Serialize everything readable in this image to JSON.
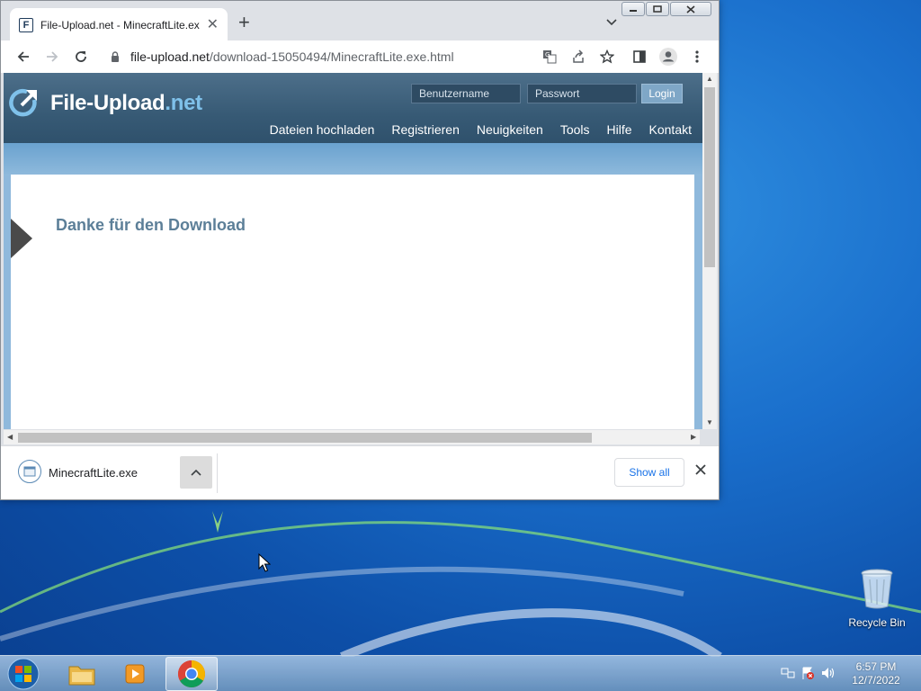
{
  "browser": {
    "tab_title": "File-Upload.net - MinecraftLite.exe",
    "tab_favicon_letter": "F",
    "url_host": "file-upload.net",
    "url_path": "/download-15050494/MinecraftLite.exe.html"
  },
  "site": {
    "logo_main": "File-Upload",
    "logo_suffix": ".net",
    "username_placeholder": "Benutzername",
    "password_placeholder": "Passwort",
    "login_label": "Login",
    "nav": [
      "Dateien hochladen",
      "Registrieren",
      "Neuigkeiten",
      "Tools",
      "Hilfe",
      "Kontakt"
    ],
    "heading": "Danke für den Download"
  },
  "download_shelf": {
    "file_name": "MinecraftLite.exe",
    "show_all_label": "Show all"
  },
  "desktop": {
    "recycle_bin_label": "Recycle Bin"
  },
  "taskbar": {
    "time": "6:57 PM",
    "date": "12/7/2022"
  }
}
